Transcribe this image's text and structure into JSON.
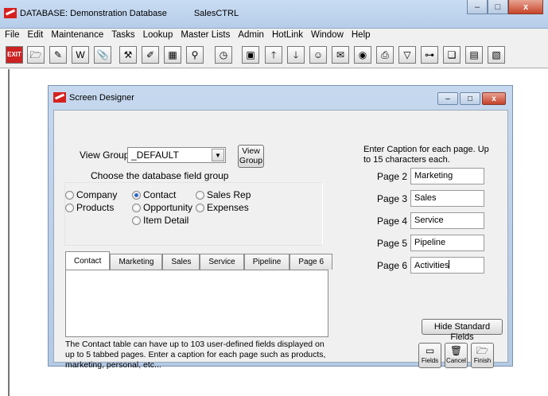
{
  "app": {
    "title_prefix": "DATABASE:  Demonstration Database",
    "app_name": "SalesCTRL",
    "min_glyph": "–",
    "max_glyph": "□",
    "close_glyph": "x"
  },
  "menubar": [
    "File",
    "Edit",
    "Maintenance",
    "Tasks",
    "Lookup",
    "Master Lists",
    "Admin",
    "HotLink",
    "Window",
    "Help"
  ],
  "toolbar": {
    "exit_label": "EXIT",
    "icons": [
      {
        "name": "folder-icon",
        "glyph": "🗁"
      },
      {
        "name": "edit-icon",
        "glyph": "✎"
      },
      {
        "name": "word-icon",
        "glyph": "W"
      },
      {
        "name": "paperclip-icon",
        "glyph": "📎"
      },
      {
        "name": "tools-icon",
        "glyph": "⚒"
      },
      {
        "name": "notepad-icon",
        "glyph": "✐"
      },
      {
        "name": "calendar-icon",
        "glyph": "▦"
      },
      {
        "name": "binoculars-icon",
        "glyph": "⚲"
      },
      {
        "name": "clock-icon",
        "glyph": "◷"
      },
      {
        "name": "window-icon",
        "glyph": "▣"
      },
      {
        "name": "up-arrow-icon",
        "glyph": "🡑"
      },
      {
        "name": "down-arrow-icon",
        "glyph": "🡓"
      },
      {
        "name": "person-icon",
        "glyph": "☺"
      },
      {
        "name": "envelope-icon",
        "glyph": "✉"
      },
      {
        "name": "globe-icon",
        "glyph": "◉"
      },
      {
        "name": "printer-icon",
        "glyph": "⎙"
      },
      {
        "name": "filter-icon",
        "glyph": "▽"
      },
      {
        "name": "network-icon",
        "glyph": "⊶"
      },
      {
        "name": "book-icon",
        "glyph": "❏"
      },
      {
        "name": "table-icon",
        "glyph": "▤"
      },
      {
        "name": "report-icon",
        "glyph": "▧"
      }
    ]
  },
  "dialog": {
    "title": "Screen Designer",
    "view_group_label": "View Group",
    "view_group_value": "_DEFAULT",
    "view_group_button": "View\nGroup",
    "choose_label": "Choose the database field group",
    "field_groups": [
      {
        "label": "Company",
        "selected": false
      },
      {
        "label": "Contact",
        "selected": true
      },
      {
        "label": "Sales Rep",
        "selected": false
      },
      {
        "label": "Products",
        "selected": false
      },
      {
        "label": "Opportunity",
        "selected": false
      },
      {
        "label": "Expenses",
        "selected": false
      },
      {
        "label": "Item Detail",
        "selected": false
      }
    ],
    "tabs": [
      "Contact",
      "Marketing",
      "Sales",
      "Service",
      "Pipeline",
      "Page 6"
    ],
    "active_tab": "Contact",
    "info_text": "The Contact table can have up to 103 user-defined fields displayed on up to 5 tabbed pages.  Enter a caption for each page such as products, marketing, personal, etc...",
    "caption_instructions": "Enter Caption for each page. Up to 15 characters each.",
    "pages": [
      {
        "label": "Page 2",
        "value": "Marketing"
      },
      {
        "label": "Page 3",
        "value": "Sales"
      },
      {
        "label": "Page 4",
        "value": "Service"
      },
      {
        "label": "Page 5",
        "value": "Pipeline"
      },
      {
        "label": "Page 6",
        "value": "Activities"
      }
    ],
    "hide_button": "Hide Standard Fields",
    "fields_button": "Fields",
    "cancel_button": "Cancel",
    "finish_button": "Finish"
  }
}
